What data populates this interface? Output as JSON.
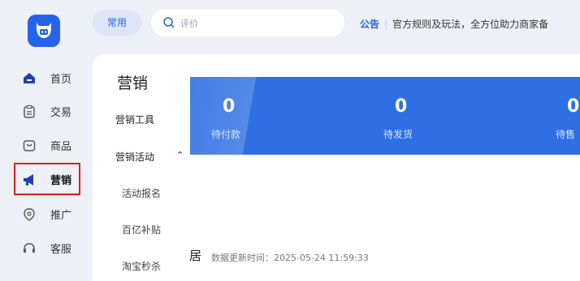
{
  "nav": {
    "items": [
      {
        "label": "首页",
        "icon": "home-icon",
        "active": false
      },
      {
        "label": "交易",
        "icon": "transaction-icon",
        "active": false
      },
      {
        "label": "商品",
        "icon": "bag-icon",
        "active": false
      },
      {
        "label": "营销",
        "icon": "megaphone-icon",
        "active": true
      },
      {
        "label": "推广",
        "icon": "promote-icon",
        "active": false
      },
      {
        "label": "客服",
        "icon": "headset-icon",
        "active": false
      }
    ]
  },
  "topbar": {
    "common_tag": "常用",
    "search_placeholder": "评价",
    "notice_keyword": "公告",
    "notice_text": "官方规则及玩法，全方位助力商家备"
  },
  "main": {
    "title": "营销",
    "submenu": {
      "tools": "营销工具",
      "activities": "营销活动",
      "children": [
        "活动报名",
        "百亿补贴",
        "淘宝秒杀"
      ]
    },
    "stats": [
      {
        "value": "0",
        "label": "待付款"
      },
      {
        "value": "0",
        "label": "待发货"
      },
      {
        "value": "0",
        "label": "待售"
      }
    ],
    "section_fragment": "居",
    "update_time": "数据更新时间：2025-05-24 11:59:33"
  },
  "colors": {
    "accent": "#2563eb",
    "banner": "#2f6fe4",
    "highlight_box": "#e11d1d"
  }
}
